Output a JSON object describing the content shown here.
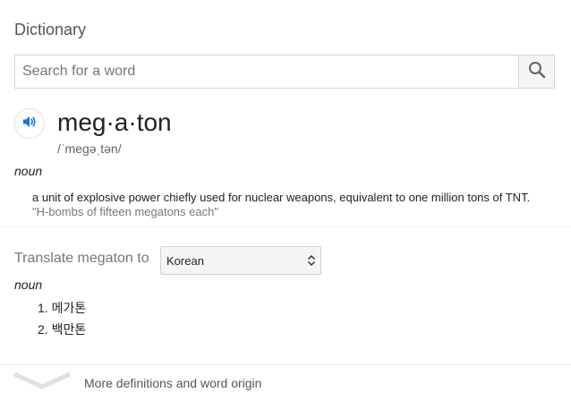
{
  "header": {
    "title": "Dictionary"
  },
  "search": {
    "placeholder": "Search for a word",
    "value": ""
  },
  "entry": {
    "word": "meg·a·ton",
    "phonetic": "/ˈmeɡəˌtən/",
    "part_of_speech": "noun",
    "definition": "a unit of explosive power chiefly used for nuclear weapons, equivalent to one million tons of TNT.",
    "example": "\"H-bombs of fifteen megatons each\""
  },
  "translate": {
    "label": "Translate megaton to",
    "language": "Korean",
    "part_of_speech": "noun",
    "items": [
      "1.  메가톤",
      "2.  백만톤"
    ]
  },
  "footer": {
    "more_label": "More definitions and word origin"
  },
  "colors": {
    "accent": "#1a73e8",
    "text": "#222222",
    "muted": "#777777",
    "border": "#d6d6d6"
  },
  "icons": {
    "search": "search-icon",
    "speaker": "speaker-icon",
    "select_arrows": "select-arrows-icon",
    "chevron": "chevron-down-icon"
  }
}
